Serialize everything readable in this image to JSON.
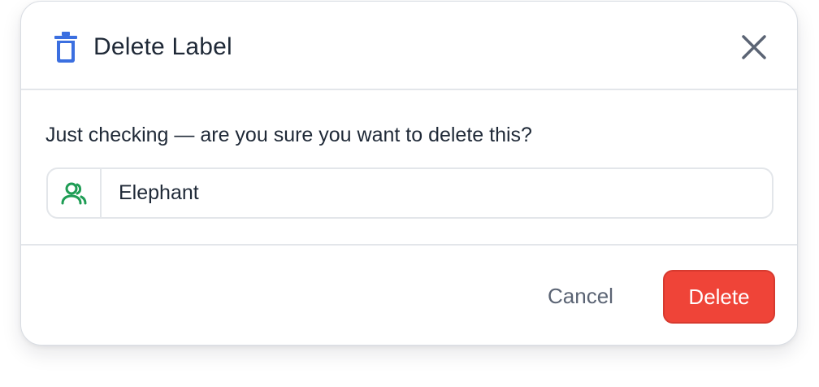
{
  "dialog": {
    "title": "Delete Label",
    "title_icon": "trash-icon",
    "close_icon": "close-icon",
    "question": "Just checking — are you sure you want to delete this?",
    "item": {
      "icon": "users-icon",
      "name": "Elephant"
    },
    "cancel_label": "Cancel",
    "delete_label": "Delete"
  },
  "colors": {
    "accent_blue": "#3b6fe0",
    "item_icon_green": "#1f9d55",
    "danger_red": "#ef4438",
    "text_dark": "#1f2937",
    "text_muted": "#5b6474",
    "border": "#e3e6ea"
  }
}
